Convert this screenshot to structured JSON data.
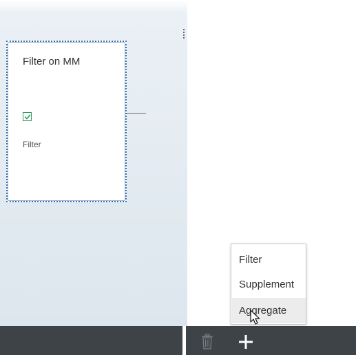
{
  "node": {
    "title": "Filter on MM",
    "type_label": "Filter",
    "enabled": true
  },
  "toolbar": {
    "delete_icon": "trash-icon",
    "add_icon": "plus-icon"
  },
  "add_menu": {
    "items": [
      {
        "label": "Filter",
        "hovered": false
      },
      {
        "label": "Supplement",
        "hovered": false
      },
      {
        "label": "Aggregate",
        "hovered": true
      }
    ]
  },
  "colors": {
    "toolbar_background": "#3e4347",
    "checkbox_accent": "#2b9a5a",
    "node_border": "#3e6fa6",
    "menu_hover": "#ececec"
  }
}
